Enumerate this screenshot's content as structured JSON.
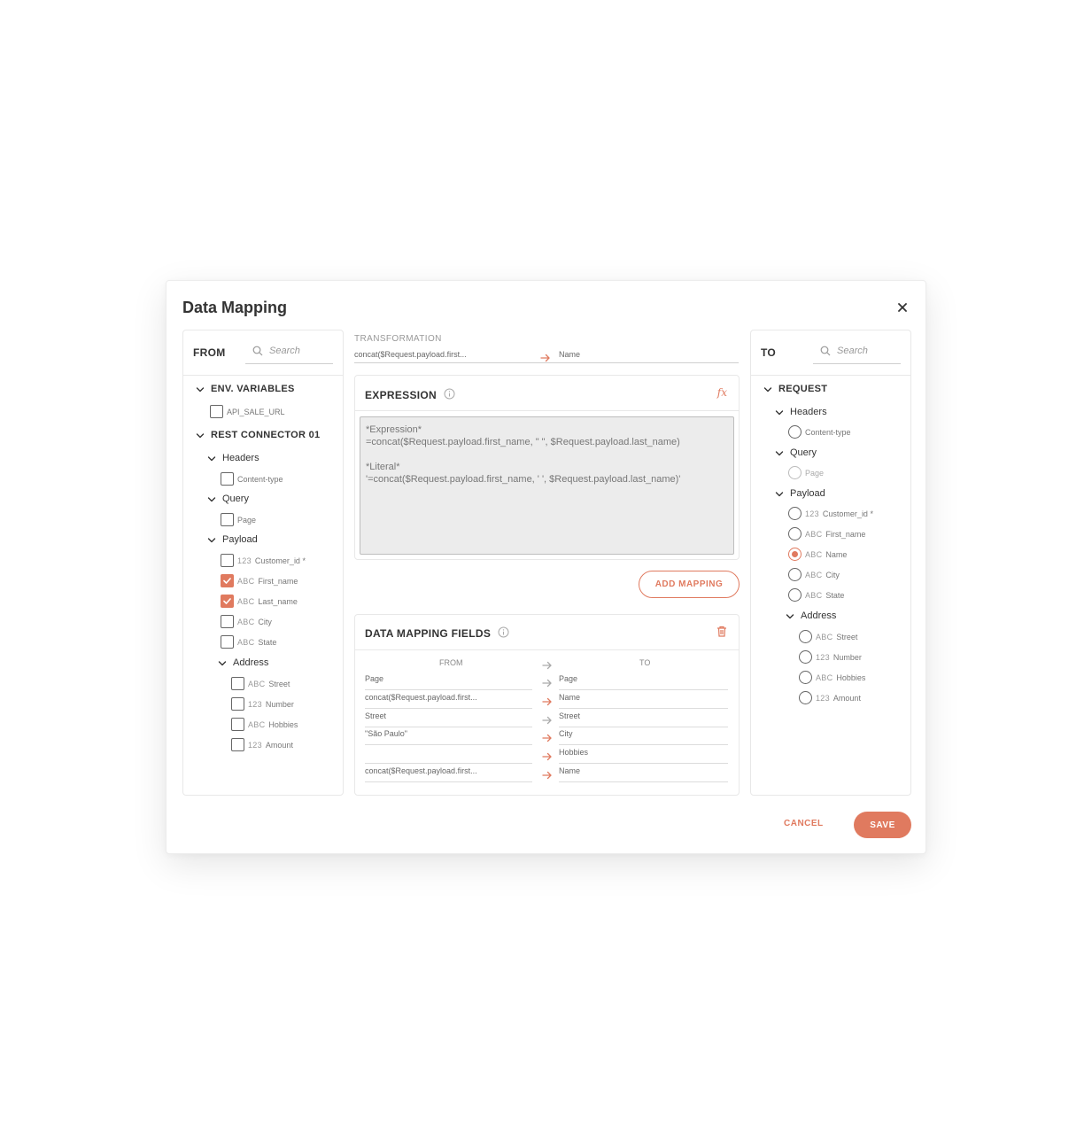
{
  "dialog": {
    "title": "Data Mapping"
  },
  "from_panel": {
    "label": "FROM",
    "search_placeholder": "Search",
    "sections": {
      "env": "ENV. VARIABLES",
      "env_item": "API_SALE_URL",
      "connector": "REST CONNECTOR 01",
      "headers": "Headers",
      "content_type": "Content-type",
      "query": "Query",
      "page": "Page",
      "payload": "Payload",
      "address": "Address"
    },
    "payload_items": [
      {
        "type": "123",
        "name": "Customer_id *",
        "checked": false
      },
      {
        "type": "ABC",
        "name": "First_name",
        "checked": true
      },
      {
        "type": "ABC",
        "name": "Last_name",
        "checked": true
      },
      {
        "type": "ABC",
        "name": "City",
        "checked": false
      },
      {
        "type": "ABC",
        "name": "State",
        "checked": false
      }
    ],
    "address_items": [
      {
        "type": "ABC",
        "name": "Street"
      },
      {
        "type": "123",
        "name": "Number"
      },
      {
        "type": "ABC",
        "name": "Hobbies"
      },
      {
        "type": "123",
        "name": "Amount"
      }
    ]
  },
  "transformation": {
    "label": "TRANSFORMATION",
    "from": "concat($Request.payload.first...",
    "to": "Name"
  },
  "expression": {
    "title": "EXPRESSION",
    "lines": [
      "*Expression*",
      "=concat($Request.payload.first_name, \" \", $Request.payload.last_name)",
      "",
      "*Literal*",
      "'=concat($Request.payload.first_name, ' ', $Request.payload.last_name)'"
    ]
  },
  "add_mapping": "ADD MAPPING",
  "mapping_fields": {
    "title": "DATA MAPPING FIELDS",
    "col_from": "FROM",
    "col_to": "TO",
    "rows": [
      {
        "from": "Page",
        "to": "Page",
        "active": false
      },
      {
        "from": "concat($Request.payload.first...",
        "to": "Name",
        "active": true
      },
      {
        "from": "Street",
        "to": "Street",
        "active": false
      },
      {
        "from": "\"São Paulo\"",
        "to": "City",
        "active": true
      },
      {
        "from": "",
        "to": "Hobbies",
        "active": true
      },
      {
        "from": "concat($Request.payload.first...",
        "to": "Name",
        "active": true
      }
    ]
  },
  "to_panel": {
    "label": "TO",
    "search_placeholder": "Search",
    "sections": {
      "request": "REQUEST",
      "headers": "Headers",
      "content_type": "Content-type",
      "query": "Query",
      "page": "Page",
      "payload": "Payload",
      "address": "Address"
    },
    "payload_items": [
      {
        "type": "123",
        "name": "Customer_id *",
        "selected": false
      },
      {
        "type": "ABC",
        "name": "First_name",
        "selected": false
      },
      {
        "type": "ABC",
        "name": "Name",
        "selected": true
      },
      {
        "type": "ABC",
        "name": "City",
        "selected": false
      },
      {
        "type": "ABC",
        "name": "State",
        "selected": false
      }
    ],
    "address_items": [
      {
        "type": "ABC",
        "name": "Street"
      },
      {
        "type": "123",
        "name": "Number"
      },
      {
        "type": "ABC",
        "name": "Hobbies"
      },
      {
        "type": "123",
        "name": "Amount"
      }
    ]
  },
  "footer": {
    "cancel": "CANCEL",
    "save": "SAVE"
  },
  "colors": {
    "accent": "#e07a5f",
    "arrow_inactive": "#aaaaaa"
  }
}
